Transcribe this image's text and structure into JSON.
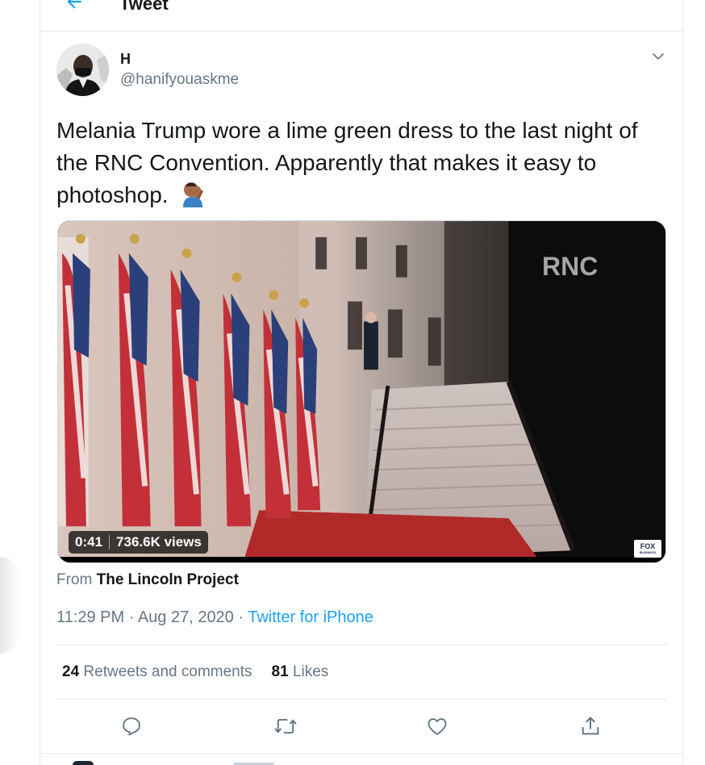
{
  "header": {
    "title": "Tweet"
  },
  "author": {
    "name": "H",
    "handle": "@hanifyouaskme"
  },
  "tweet": {
    "text": "Melania Trump wore a lime green dress to the last night of the RNC Convention. Apparently that makes it easy to photoshop."
  },
  "media": {
    "watermark": "RNC",
    "duration": "0:41",
    "views": "736.6K views",
    "corner_logo": "FOX",
    "corner_logo_sub": "BUSINESS"
  },
  "source": {
    "prefix": "From",
    "name": "The Lincoln Project"
  },
  "meta": {
    "time": "11:29 PM",
    "sep1": "·",
    "date": "Aug 27, 2020",
    "sep2": "·",
    "client": "Twitter for iPhone"
  },
  "stats": {
    "retweets_count": "24",
    "retweets_label": "Retweets and comments",
    "likes_count": "81",
    "likes_label": "Likes"
  },
  "icons": {
    "back": "arrow-left-icon",
    "caret": "chevron-down-icon",
    "reply": "reply-icon",
    "retweet": "retweet-icon",
    "like": "heart-icon",
    "share": "share-icon",
    "emoji": "face-palm-emoji"
  },
  "colors": {
    "accent": "#1da1f2",
    "text": "#14171a",
    "secondary": "#657786",
    "border": "#e6ecf0"
  }
}
